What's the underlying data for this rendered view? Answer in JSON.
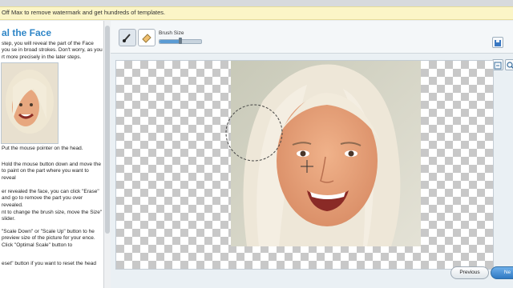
{
  "banner": {
    "text": "Off Max to remove watermark and get hundreds of templates."
  },
  "left_panel": {
    "title": "al the Face",
    "intro": "step, you will reveal the part of the Face you se in broad strokes. Don't worry, as you rt more precisely in the later steps.",
    "steps": [
      {
        "text": "Put the mouse pointer on the head."
      },
      {
        "text": "Hold the mouse button down and move the to paint on the part where you want to reveal"
      },
      {
        "text": "er revealed the face, you can click \"Erase\" and go to remove the part you over revealed."
      },
      {
        "text": "nt to change the brush size, move the Size\" slider."
      },
      {
        "text": "\"Scale Down\" or \"Scale Up\" button to he preview size of the picture for your ence. Click \"Optimal Scale\" button to"
      },
      {
        "text": "eset\" button if you want to reset the head"
      }
    ]
  },
  "toolbar": {
    "brush_size_label": "Brush Size",
    "brush_size_level": 0.5
  },
  "footer": {
    "previous_label": "Previous",
    "next_label": "Ne"
  },
  "icons": {
    "brush": "brush-icon",
    "eraser": "eraser-icon",
    "save": "save-icon",
    "scale_down": "scale-down-icon",
    "scale_up": "zoom-icon"
  },
  "colors": {
    "accent": "#2f86c7",
    "next_button": "#2f79c3",
    "banner_bg": "#fbf5c7"
  }
}
